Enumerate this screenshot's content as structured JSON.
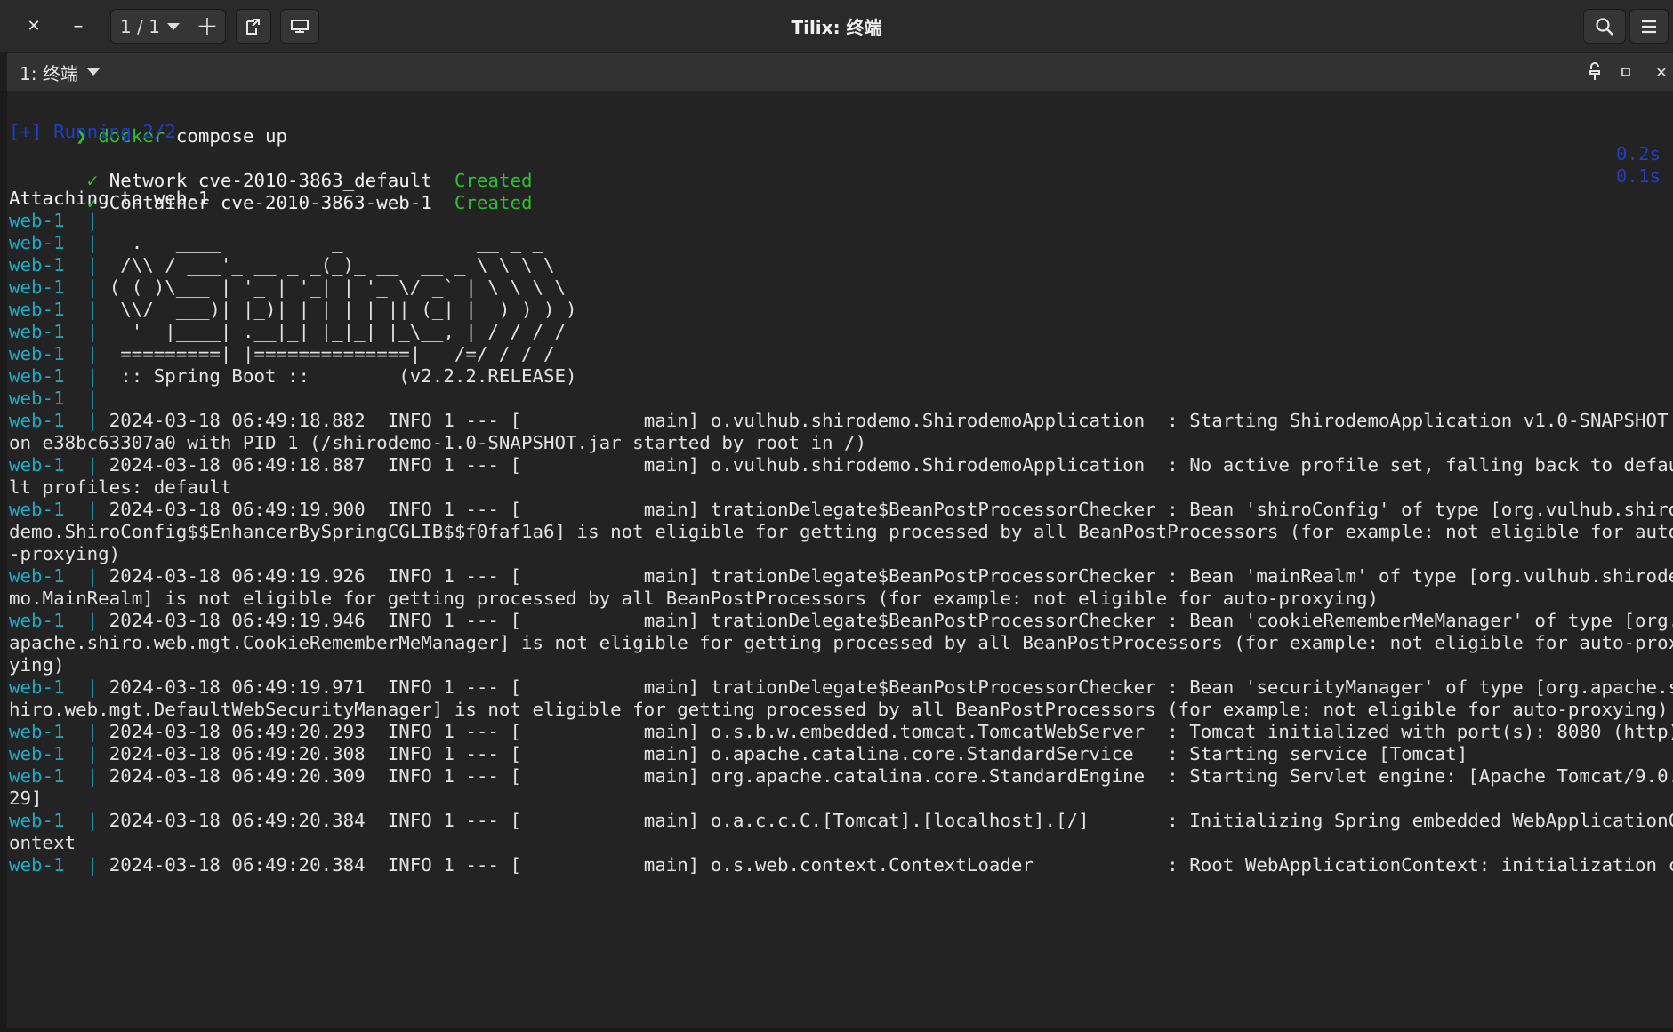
{
  "window": {
    "title": "Tilix: 终端",
    "session_selector": "1 / 1",
    "close_glyph": "✕",
    "minimize_glyph": "–",
    "add_glyph": "+",
    "icons": [
      "close-icon",
      "minimize-icon",
      "chevron-down-icon",
      "add-icon",
      "detach-icon",
      "sync-input-icon",
      "search-icon",
      "hamburger-menu-icon"
    ]
  },
  "terminal_tab": {
    "title": "1: 终端",
    "icons": [
      "read-only-icon",
      "maximize-icon",
      "close-icon"
    ]
  },
  "colors": {
    "prompt_green": "#2ec02e",
    "service_cyan": "#1fa9c4",
    "progress_blue": "#1f3fc4",
    "text": "#e2e2e2",
    "background": "#232323"
  },
  "terminal": {
    "prompt_symbol": "❯",
    "command_name": "docker",
    "command_args": " compose up",
    "running": "[+] Running 2/2",
    "network_check": " ✓",
    "network_label": "Network cve-2010-3863_default",
    "network_status": "Created",
    "network_time": "0.2s",
    "container_check": " ✓",
    "container_label": "Container cve-2010-3863-web-1",
    "container_status": "Created",
    "container_time": "0.1s",
    "attaching": "Attaching to web-1",
    "service_prefix": "web-1  |",
    "banner": [
      "",
      "   .   ____          _            __ _ _",
      "  /\\\\ / ___'_ __ _ _(_)_ __  __ _ \\ \\ \\ \\",
      " ( ( )\\___ | '_ | '_| | '_ \\/ _` | \\ \\ \\ \\",
      "  \\\\/  ___)| |_)| | | | | || (_| |  ) ) ) )",
      "   '  |____| .__|_| |_|_| |_\\__, | / / / /",
      "  =========|_|==============|___/=/_/_/_/",
      "  :: Spring Boot ::        (v2.2.2.RELEASE)",
      ""
    ],
    "log_lines": [
      {
        "prefix": true,
        "text": " 2024-03-18 06:49:18.882  INFO 1 --- [           main] o.vulhub.shirodemo.ShirodemoApplication  : Starting ShirodemoApplication v1.0-SNAPSHOT"
      },
      {
        "prefix": false,
        "text": "on e38bc63307a0 with PID 1 (/shirodemo-1.0-SNAPSHOT.jar started by root in /)"
      },
      {
        "prefix": true,
        "text": " 2024-03-18 06:49:18.887  INFO 1 --- [           main] o.vulhub.shirodemo.ShirodemoApplication  : No active profile set, falling back to defau"
      },
      {
        "prefix": false,
        "text": "lt profiles: default"
      },
      {
        "prefix": true,
        "text": " 2024-03-18 06:49:19.900  INFO 1 --- [           main] trationDelegate$BeanPostProcessorChecker : Bean 'shiroConfig' of type [org.vulhub.shiro"
      },
      {
        "prefix": false,
        "text": "demo.ShiroConfig$$EnhancerBySpringCGLIB$$f0faf1a6] is not eligible for getting processed by all BeanPostProcessors (for example: not eligible for auto"
      },
      {
        "prefix": false,
        "text": "-proxying)"
      },
      {
        "prefix": true,
        "text": " 2024-03-18 06:49:19.926  INFO 1 --- [           main] trationDelegate$BeanPostProcessorChecker : Bean 'mainRealm' of type [org.vulhub.shirode"
      },
      {
        "prefix": false,
        "text": "mo.MainRealm] is not eligible for getting processed by all BeanPostProcessors (for example: not eligible for auto-proxying)"
      },
      {
        "prefix": true,
        "text": " 2024-03-18 06:49:19.946  INFO 1 --- [           main] trationDelegate$BeanPostProcessorChecker : Bean 'cookieRememberMeManager' of type [org."
      },
      {
        "prefix": false,
        "text": "apache.shiro.web.mgt.CookieRememberMeManager] is not eligible for getting processed by all BeanPostProcessors (for example: not eligible for auto-prox"
      },
      {
        "prefix": false,
        "text": "ying)"
      },
      {
        "prefix": true,
        "text": " 2024-03-18 06:49:19.971  INFO 1 --- [           main] trationDelegate$BeanPostProcessorChecker : Bean 'securityManager' of type [org.apache.s"
      },
      {
        "prefix": false,
        "text": "hiro.web.mgt.DefaultWebSecurityManager] is not eligible for getting processed by all BeanPostProcessors (for example: not eligible for auto-proxying)"
      },
      {
        "prefix": true,
        "text": " 2024-03-18 06:49:20.293  INFO 1 --- [           main] o.s.b.w.embedded.tomcat.TomcatWebServer  : Tomcat initialized with port(s): 8080 (http)"
      },
      {
        "prefix": true,
        "text": " 2024-03-18 06:49:20.308  INFO 1 --- [           main] o.apache.catalina.core.StandardService   : Starting service [Tomcat]"
      },
      {
        "prefix": true,
        "text": " 2024-03-18 06:49:20.309  INFO 1 --- [           main] org.apache.catalina.core.StandardEngine  : Starting Servlet engine: [Apache Tomcat/9.0."
      },
      {
        "prefix": false,
        "text": "29]"
      },
      {
        "prefix": true,
        "text": " 2024-03-18 06:49:20.384  INFO 1 --- [           main] o.a.c.c.C.[Tomcat].[localhost].[/]       : Initializing Spring embedded WebApplicationC"
      },
      {
        "prefix": false,
        "text": "ontext"
      },
      {
        "prefix": true,
        "text": " 2024-03-18 06:49:20.384  INFO 1 --- [           main] o.s.web.context.ContextLoader            : Root WebApplicationContext: initialization c"
      }
    ]
  }
}
